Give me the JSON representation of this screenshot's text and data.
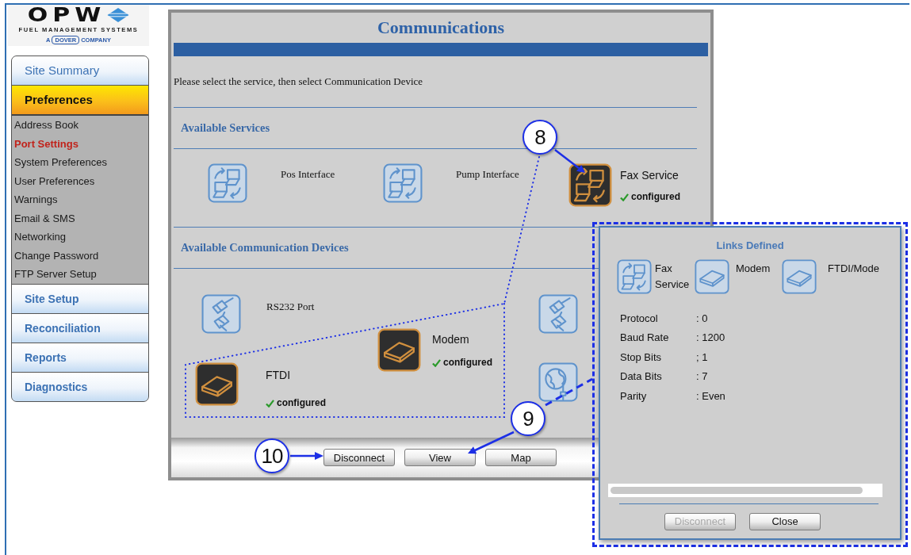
{
  "logo": {
    "wordmark": "OPW",
    "tagline": "FUEL MANAGEMENT SYSTEMS",
    "parent": [
      "A",
      "DOVER",
      "COMPANY"
    ]
  },
  "sidebar": {
    "items": [
      {
        "kind": "main",
        "label": "Site Summary",
        "selected": false
      },
      {
        "kind": "main",
        "label": "Preferences",
        "selected": true
      },
      {
        "kind": "sub",
        "label": "Address Book",
        "selected": false
      },
      {
        "kind": "sub",
        "label": "Port Settings",
        "selected": true
      },
      {
        "kind": "sub",
        "label": "System Preferences",
        "selected": false
      },
      {
        "kind": "sub",
        "label": "User Preferences",
        "selected": false
      },
      {
        "kind": "sub",
        "label": "Warnings",
        "selected": false
      },
      {
        "kind": "sub",
        "label": "Email & SMS",
        "selected": false
      },
      {
        "kind": "sub",
        "label": "Networking",
        "selected": false
      },
      {
        "kind": "sub",
        "label": "Change Password",
        "selected": false
      },
      {
        "kind": "sub",
        "label": "FTP Server Setup",
        "selected": false
      },
      {
        "kind": "main",
        "label": "Site Setup",
        "selected": false
      },
      {
        "kind": "main",
        "label": "Reconciliation",
        "selected": false
      },
      {
        "kind": "main",
        "label": "Reports",
        "selected": false
      },
      {
        "kind": "main",
        "label": "Diagnostics",
        "selected": false
      }
    ]
  },
  "panel": {
    "title": "Communications",
    "instruction": "Please select the service, then select Communication Device",
    "services_heading": "Available Services",
    "services": [
      {
        "kind": "network",
        "label": "Pos Interface",
        "selected": false
      },
      {
        "kind": "network",
        "label": "Pump Interface",
        "selected": false
      },
      {
        "kind": "network",
        "label": "Fax Service",
        "selected": true,
        "status": "configured"
      }
    ],
    "devices_heading": "Available Communication Devices",
    "devices": [
      {
        "kind": "serial",
        "label": "RS232 Port",
        "selected": false
      },
      {
        "kind": "serial",
        "selected": false
      },
      {
        "kind": "drive",
        "label": "Modem",
        "selected": true,
        "status": "configured"
      },
      {
        "kind": "drive",
        "label": "FTDI",
        "selected": true,
        "status": "configured"
      },
      {
        "kind": "globe",
        "selected": false
      }
    ],
    "buttons": [
      "Disconnect",
      "View",
      "Map"
    ]
  },
  "dialog": {
    "title": "Links Defined",
    "links": [
      {
        "kind": "network",
        "label": "Fax Service"
      },
      {
        "kind": "drive",
        "label": "Modem"
      },
      {
        "kind": "drive",
        "label": "FTDI/Mode"
      }
    ],
    "fields": [
      {
        "label": "Protocol",
        "value": ": 0"
      },
      {
        "label": "Baud Rate",
        "value": ": 1200"
      },
      {
        "label": "Stop Bits",
        "value": "; 1"
      },
      {
        "label": "Data Bits",
        "value": ": 7"
      },
      {
        "label": "Parity",
        "value": ": Even"
      }
    ],
    "buttons": [
      {
        "label": "Disconnect",
        "disabled": true
      },
      {
        "label": "Close",
        "disabled": false
      }
    ]
  },
  "callouts": [
    {
      "number": "8"
    },
    {
      "number": "9"
    },
    {
      "number": "10"
    }
  ]
}
